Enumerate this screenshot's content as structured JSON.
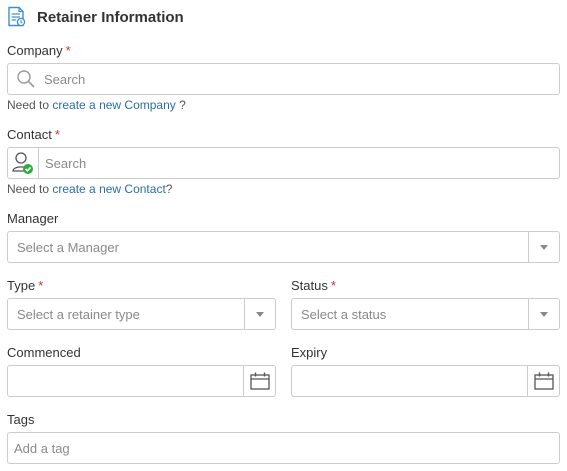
{
  "section": {
    "title": "Retainer Information",
    "icon": "retainer-document-icon"
  },
  "company": {
    "label": "Company",
    "required_mark": "*",
    "placeholder": "Search",
    "help_prefix": "Need to ",
    "help_link": "create a new Company",
    "help_suffix": " ?"
  },
  "contact": {
    "label": "Contact",
    "required_mark": "*",
    "placeholder": "Search",
    "help_prefix": "Need to ",
    "help_link": "create a new Contact",
    "help_suffix": "?"
  },
  "manager": {
    "label": "Manager",
    "placeholder": "Select a Manager"
  },
  "type": {
    "label": "Type",
    "required_mark": "*",
    "placeholder": "Select a retainer type"
  },
  "status": {
    "label": "Status",
    "required_mark": "*",
    "placeholder": "Select a status"
  },
  "commenced": {
    "label": "Commenced",
    "value": ""
  },
  "expiry": {
    "label": "Expiry",
    "value": ""
  },
  "tags": {
    "label": "Tags",
    "placeholder": "Add a tag"
  },
  "colors": {
    "link": "#2a6fa8",
    "required": "#d32f2f",
    "border": "#cccccc",
    "accent_icon": "#3d8fd1",
    "contact_check": "#2eaa3f"
  }
}
